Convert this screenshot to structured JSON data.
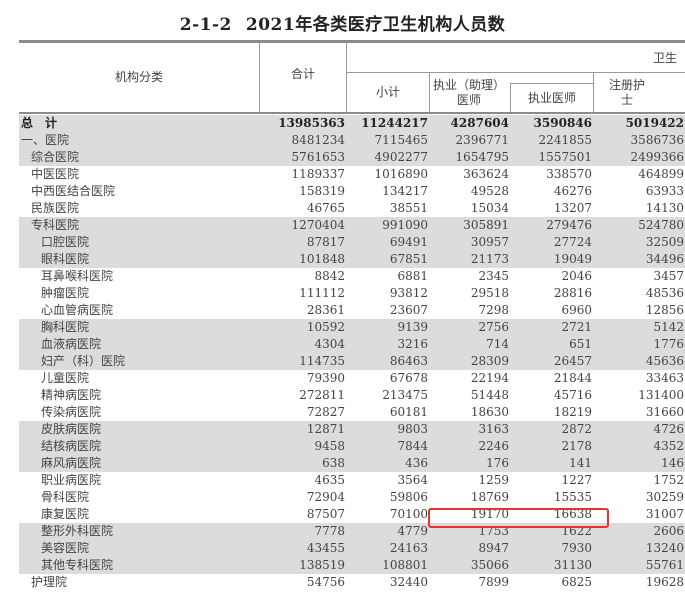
{
  "title": {
    "number": "2-1-2",
    "text": "2021年各类医疗卫生机构人员数"
  },
  "header": {
    "category": "机构分类",
    "total": "合计",
    "group": "卫生",
    "subtotal": "小计",
    "practicing_asst_physician": "执业（助理）医师",
    "practicing_physician": "执业医师",
    "registered_nurse": "注册护士"
  },
  "columns": [
    "机构分类",
    "合计",
    "小计",
    "执业（助理）医师",
    "执业医师",
    "注册护士"
  ],
  "rows": [
    {
      "name": "总　计",
      "indent": 0,
      "bold": true,
      "shade": true,
      "values": [
        "13985363",
        "11244217",
        "4287604",
        "3590846",
        "5019422"
      ]
    },
    {
      "name": "一、医院",
      "indent": 0,
      "shade": true,
      "values": [
        "8481234",
        "7115465",
        "2396771",
        "2241855",
        "3586736"
      ]
    },
    {
      "name": "综合医院",
      "indent": 1,
      "shade": true,
      "values": [
        "5761653",
        "4902277",
        "1654795",
        "1557501",
        "2499366"
      ]
    },
    {
      "name": "中医医院",
      "indent": 1,
      "shade": false,
      "values": [
        "1189337",
        "1016890",
        "363624",
        "338570",
        "464899"
      ]
    },
    {
      "name": "中西医结合医院",
      "indent": 1,
      "shade": false,
      "values": [
        "158319",
        "134217",
        "49528",
        "46276",
        "63933"
      ]
    },
    {
      "name": "民族医院",
      "indent": 1,
      "shade": false,
      "values": [
        "46765",
        "38551",
        "15034",
        "13207",
        "14130"
      ]
    },
    {
      "name": "专科医院",
      "indent": 1,
      "shade": true,
      "values": [
        "1270404",
        "991090",
        "305891",
        "279476",
        "524780"
      ]
    },
    {
      "name": "口腔医院",
      "indent": 2,
      "shade": true,
      "values": [
        "87817",
        "69491",
        "30957",
        "27724",
        "32509"
      ]
    },
    {
      "name": "眼科医院",
      "indent": 2,
      "shade": true,
      "values": [
        "101848",
        "67851",
        "21173",
        "19049",
        "34496"
      ]
    },
    {
      "name": "耳鼻喉科医院",
      "indent": 2,
      "shade": false,
      "values": [
        "8842",
        "6881",
        "2345",
        "2046",
        "3457"
      ]
    },
    {
      "name": "肿瘤医院",
      "indent": 2,
      "shade": false,
      "values": [
        "111112",
        "93812",
        "29518",
        "28816",
        "48536"
      ]
    },
    {
      "name": "心血管病医院",
      "indent": 2,
      "shade": false,
      "values": [
        "28361",
        "23607",
        "7298",
        "6960",
        "12856"
      ]
    },
    {
      "name": "胸科医院",
      "indent": 2,
      "shade": true,
      "values": [
        "10592",
        "9139",
        "2756",
        "2721",
        "5142"
      ]
    },
    {
      "name": "血液病医院",
      "indent": 2,
      "shade": true,
      "values": [
        "4304",
        "3216",
        "714",
        "651",
        "1776"
      ]
    },
    {
      "name": "妇产（科）医院",
      "indent": 2,
      "shade": true,
      "values": [
        "114735",
        "86463",
        "28309",
        "26457",
        "45636"
      ]
    },
    {
      "name": "儿童医院",
      "indent": 2,
      "shade": false,
      "values": [
        "79390",
        "67678",
        "22194",
        "21844",
        "33463"
      ]
    },
    {
      "name": "精神病医院",
      "indent": 2,
      "shade": false,
      "values": [
        "272811",
        "213475",
        "51448",
        "45716",
        "131400"
      ]
    },
    {
      "name": "传染病医院",
      "indent": 2,
      "shade": false,
      "values": [
        "72827",
        "60181",
        "18630",
        "18219",
        "31660"
      ]
    },
    {
      "name": "皮肤病医院",
      "indent": 2,
      "shade": true,
      "values": [
        "12871",
        "9803",
        "3163",
        "2872",
        "4726"
      ]
    },
    {
      "name": "结核病医院",
      "indent": 2,
      "shade": true,
      "values": [
        "9458",
        "7844",
        "2246",
        "2178",
        "4352"
      ]
    },
    {
      "name": "麻风病医院",
      "indent": 2,
      "shade": true,
      "values": [
        "638",
        "436",
        "176",
        "141",
        "146"
      ]
    },
    {
      "name": "职业病医院",
      "indent": 2,
      "shade": false,
      "values": [
        "4635",
        "3564",
        "1259",
        "1227",
        "1752"
      ]
    },
    {
      "name": "骨科医院",
      "indent": 2,
      "shade": false,
      "values": [
        "72904",
        "59806",
        "18769",
        "15535",
        "30259"
      ]
    },
    {
      "name": "康复医院",
      "indent": 2,
      "shade": false,
      "values": [
        "87507",
        "70100",
        "19170",
        "16638",
        "31007"
      ]
    },
    {
      "name": "整形外科医院",
      "indent": 2,
      "shade": true,
      "values": [
        "7778",
        "4779",
        "1753",
        "1622",
        "2606"
      ]
    },
    {
      "name": "美容医院",
      "indent": 2,
      "shade": true,
      "values": [
        "43455",
        "24163",
        "8947",
        "7930",
        "13240"
      ]
    },
    {
      "name": "其他专科医院",
      "indent": 2,
      "shade": true,
      "values": [
        "138519",
        "108801",
        "35066",
        "31130",
        "55761"
      ]
    },
    {
      "name": "护理院",
      "indent": 1,
      "shade": false,
      "values": [
        "54756",
        "32440",
        "7899",
        "6825",
        "19628"
      ]
    }
  ],
  "annotation": {
    "highlighted_row": "康复医院",
    "highlighted_cells": [
      "19170",
      "16638"
    ],
    "color": "#e8322c"
  }
}
